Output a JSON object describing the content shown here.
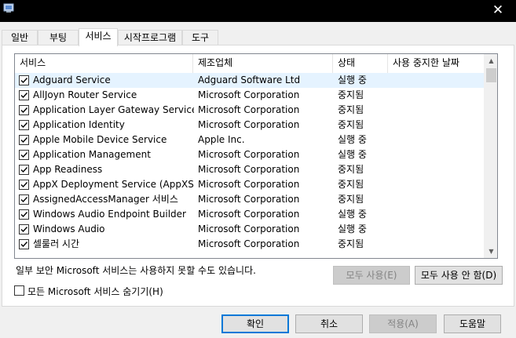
{
  "titlebar": {
    "close_glyph": "✕"
  },
  "tabs": [
    {
      "label": "일반"
    },
    {
      "label": "부팅"
    },
    {
      "label": "서비스"
    },
    {
      "label": "시작프로그램"
    },
    {
      "label": "도구"
    }
  ],
  "columns": {
    "service": "서비스",
    "manufacturer": "제조업체",
    "status": "상태",
    "date_disabled": "사용 중지한 날짜"
  },
  "rows": [
    {
      "name": "Adguard Service",
      "manufacturer": "Adguard Software Ltd",
      "status": "실행 중",
      "checked": true
    },
    {
      "name": "AllJoyn Router Service",
      "manufacturer": "Microsoft Corporation",
      "status": "중지됨",
      "checked": true
    },
    {
      "name": "Application Layer Gateway Service",
      "manufacturer": "Microsoft Corporation",
      "status": "중지됨",
      "checked": true
    },
    {
      "name": "Application Identity",
      "manufacturer": "Microsoft Corporation",
      "status": "중지됨",
      "checked": true
    },
    {
      "name": "Apple Mobile Device Service",
      "manufacturer": "Apple Inc.",
      "status": "실행 중",
      "checked": true
    },
    {
      "name": "Application Management",
      "manufacturer": "Microsoft Corporation",
      "status": "실행 중",
      "checked": true
    },
    {
      "name": "App Readiness",
      "manufacturer": "Microsoft Corporation",
      "status": "중지됨",
      "checked": true
    },
    {
      "name": "AppX Deployment Service (AppXSV...",
      "manufacturer": "Microsoft Corporation",
      "status": "중지됨",
      "checked": true
    },
    {
      "name": "AssignedAccessManager 서비스",
      "manufacturer": "Microsoft Corporation",
      "status": "중지됨",
      "checked": true
    },
    {
      "name": "Windows Audio Endpoint Builder",
      "manufacturer": "Microsoft Corporation",
      "status": "실행 중",
      "checked": true
    },
    {
      "name": "Windows Audio",
      "manufacturer": "Microsoft Corporation",
      "status": "실행 중",
      "checked": true
    },
    {
      "name": "셀룰러 시간",
      "manufacturer": "Microsoft Corporation",
      "status": "중지됨",
      "checked": true
    }
  ],
  "note": "일부 보안 Microsoft 서비스는 사용하지 못할 수도 있습니다.",
  "buttons": {
    "enable_all": "모두 사용(E)",
    "disable_all": "모두 사용 안 함(D)",
    "ok": "확인",
    "cancel": "취소",
    "apply": "적용(A)",
    "help": "도움말"
  },
  "hide_ms_label": "모든 Microsoft 서비스 숨기기(H)",
  "colors": {
    "selected_row": "#e5f3ff",
    "default_button_border": "#0078d7"
  }
}
